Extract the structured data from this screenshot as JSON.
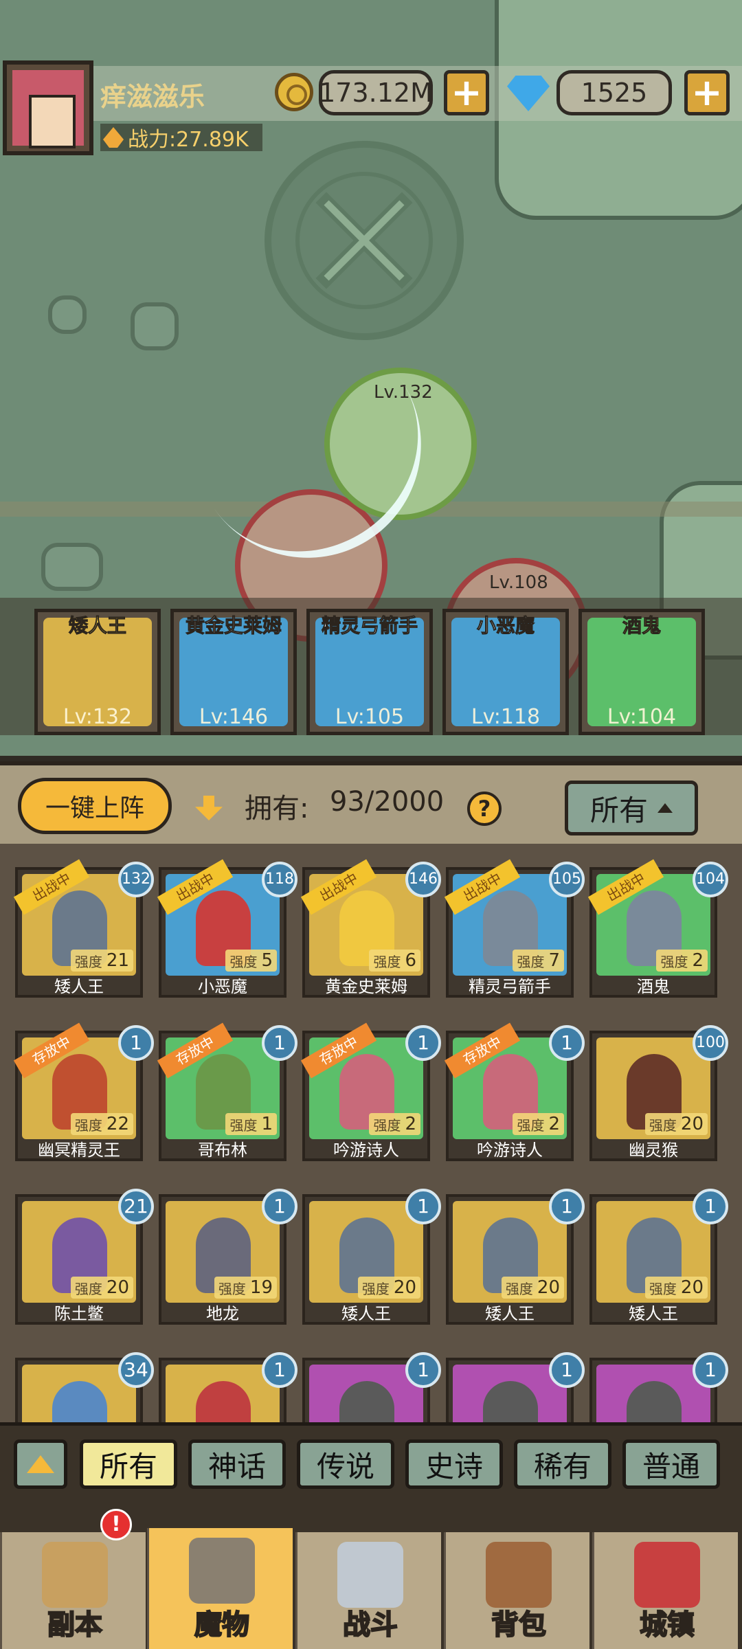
{
  "player": {
    "name": "痒滋滋乐",
    "power": "战力:27.89K",
    "gold": "173.12M",
    "gems": "1525"
  },
  "battle": {
    "unit_levels": [
      "Lv.132",
      "Lv.108"
    ]
  },
  "lineup": [
    {
      "name": "矮人王",
      "level": "Lv:132",
      "color": "#d8b24a"
    },
    {
      "name": "黄金史莱姆",
      "level": "Lv:146",
      "color": "#4a9fd0"
    },
    {
      "name": "精灵弓箭手",
      "level": "Lv:105",
      "color": "#4a9fd0"
    },
    {
      "name": "小恶魔",
      "level": "Lv:118",
      "color": "#4a9fd0"
    },
    {
      "name": "酒鬼",
      "level": "Lv:104",
      "color": "#5cbf6a"
    }
  ],
  "panel": {
    "deploy_label": "一键上阵",
    "owned_label": "拥有:",
    "owned_value": "93/2000",
    "help": "?",
    "filter": "所有"
  },
  "monsters": [
    {
      "name": "矮人王",
      "level": "132",
      "strength": "21",
      "status": "出战中",
      "bg": "#d8b24a",
      "fig": "#6b7a8a"
    },
    {
      "name": "小恶魔",
      "level": "118",
      "strength": "5",
      "status": "出战中",
      "bg": "#4a9fd0",
      "fig": "#c84040"
    },
    {
      "name": "黄金史莱姆",
      "level": "146",
      "strength": "6",
      "status": "出战中",
      "bg": "#d8b24a",
      "fig": "#f0c840"
    },
    {
      "name": "精灵弓箭手",
      "level": "105",
      "strength": "7",
      "status": "出战中",
      "bg": "#4a9fd0",
      "fig": "#7a8a9a"
    },
    {
      "name": "酒鬼",
      "level": "104",
      "strength": "2",
      "status": "出战中",
      "bg": "#5cbf6a",
      "fig": "#7a8a9a"
    },
    {
      "name": "幽冥精灵王",
      "level": "1",
      "strength": "22",
      "status": "存放中",
      "bg": "#d8b24a",
      "fig": "#c05030"
    },
    {
      "name": "哥布林",
      "level": "1",
      "strength": "1",
      "status": "存放中",
      "bg": "#5cbf6a",
      "fig": "#6a9a4a"
    },
    {
      "name": "吟游诗人",
      "level": "1",
      "strength": "2",
      "status": "存放中",
      "bg": "#5cbf6a",
      "fig": "#c86a7a"
    },
    {
      "name": "吟游诗人",
      "level": "1",
      "strength": "2",
      "status": "存放中",
      "bg": "#5cbf6a",
      "fig": "#c86a7a"
    },
    {
      "name": "幽灵猴",
      "level": "100",
      "strength": "20",
      "status": "",
      "bg": "#d8b24a",
      "fig": "#6a3a2a"
    },
    {
      "name": "陈土鳖",
      "level": "21",
      "strength": "20",
      "status": "",
      "bg": "#d8b24a",
      "fig": "#7a5aa0"
    },
    {
      "name": "地龙",
      "level": "1",
      "strength": "19",
      "status": "",
      "bg": "#d8b24a",
      "fig": "#6a6a7a"
    },
    {
      "name": "矮人王",
      "level": "1",
      "strength": "20",
      "status": "",
      "bg": "#d8b24a",
      "fig": "#6b7a8a"
    },
    {
      "name": "矮人王",
      "level": "1",
      "strength": "20",
      "status": "",
      "bg": "#d8b24a",
      "fig": "#6b7a8a"
    },
    {
      "name": "矮人王",
      "level": "1",
      "strength": "20",
      "status": "",
      "bg": "#d8b24a",
      "fig": "#6b7a8a"
    },
    {
      "name": "",
      "level": "34",
      "strength": "",
      "status": "",
      "bg": "#d8b24a",
      "fig": "#5a8ac0"
    },
    {
      "name": "",
      "level": "1",
      "strength": "",
      "status": "",
      "bg": "#d8b24a",
      "fig": "#c04040"
    },
    {
      "name": "",
      "level": "1",
      "strength": "",
      "status": "",
      "bg": "#b050b0",
      "fig": "#5a5a5a"
    },
    {
      "name": "",
      "level": "1",
      "strength": "",
      "status": "",
      "bg": "#b050b0",
      "fig": "#5a5a5a"
    },
    {
      "name": "",
      "level": "1",
      "strength": "",
      "status": "",
      "bg": "#b050b0",
      "fig": "#5a5a5a"
    }
  ],
  "strength_label": "强度",
  "rarity_filters": [
    "所有",
    "神话",
    "传说",
    "史诗",
    "稀有",
    "普通"
  ],
  "nav": [
    {
      "label": "副本",
      "icon": "map-icon",
      "color": "#c8a060"
    },
    {
      "label": "魔物",
      "icon": "helmet-icon",
      "color": "#8a8070"
    },
    {
      "label": "战斗",
      "icon": "crossed-swords-icon",
      "color": "#c0c8d0"
    },
    {
      "label": "背包",
      "icon": "backpack-icon",
      "color": "#a06a40"
    },
    {
      "label": "城镇",
      "icon": "shop-icon",
      "color": "#c84040"
    }
  ],
  "notification": "!"
}
